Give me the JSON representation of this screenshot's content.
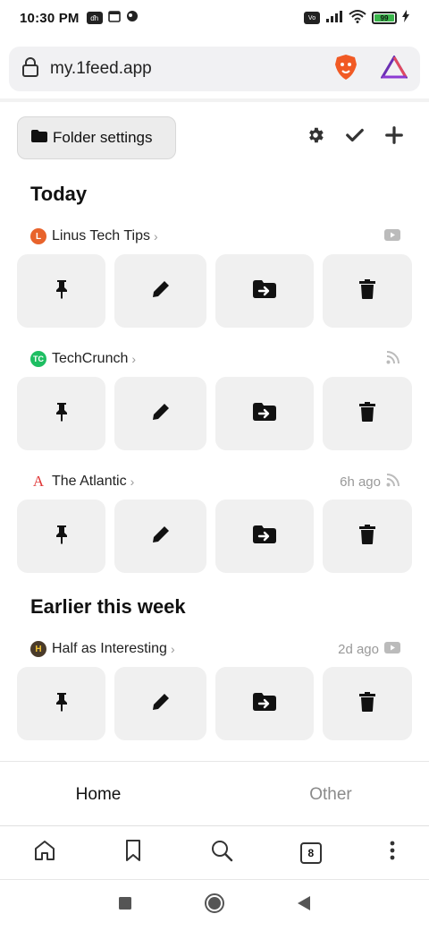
{
  "status": {
    "time": "10:30 PM",
    "battery": "99"
  },
  "browser": {
    "url": "my.1feed.app",
    "tab_count": "8"
  },
  "toolbar": {
    "folder_settings": "Folder settings"
  },
  "sections": [
    {
      "title": "Today",
      "items": [
        {
          "source": "Linus Tech Tips",
          "time": "",
          "type": "youtube",
          "icon_color": "#e8632b"
        },
        {
          "source": "TechCrunch",
          "time": "",
          "type": "rss",
          "icon_color": "#1ebe62"
        },
        {
          "source": "The Atlantic",
          "time": "6h ago",
          "type": "rss",
          "icon_color": "#e03636"
        }
      ]
    },
    {
      "title": "Earlier this week",
      "items": [
        {
          "source": "Half as Interesting",
          "time": "2d ago",
          "type": "youtube",
          "icon_color": "#4a3b2a"
        }
      ]
    }
  ],
  "tabs": {
    "home": "Home",
    "other": "Other"
  }
}
